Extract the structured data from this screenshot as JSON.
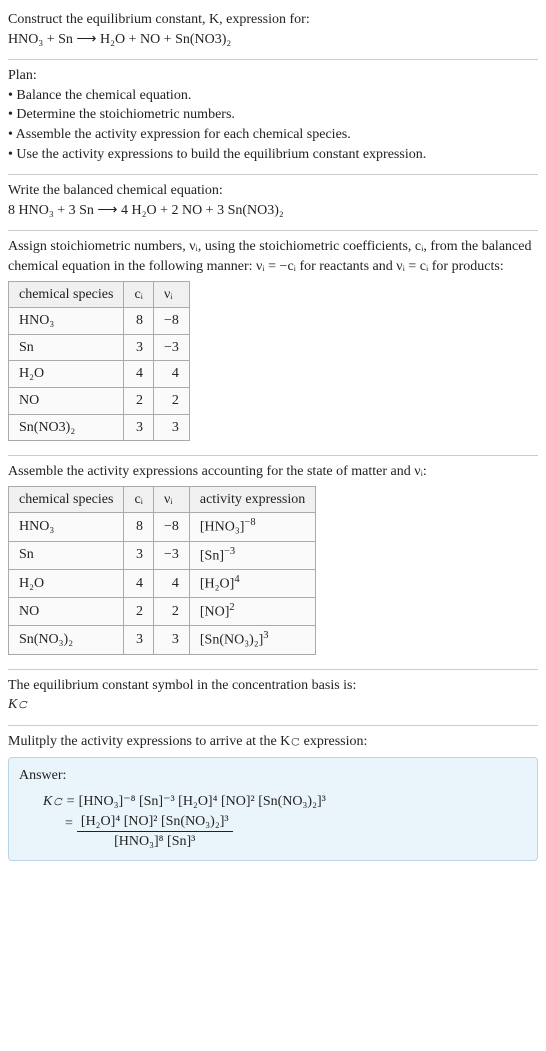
{
  "intro": {
    "line1": "Construct the equilibrium constant, K, expression for:",
    "equation": "HNO₃ + Sn ⟶ H₂O + NO + Sn(NO3)₂"
  },
  "plan": {
    "heading": "Plan:",
    "items": [
      "• Balance the chemical equation.",
      "• Determine the stoichiometric numbers.",
      "• Assemble the activity expression for each chemical species.",
      "• Use the activity expressions to build the equilibrium constant expression."
    ]
  },
  "balanced": {
    "heading": "Write the balanced chemical equation:",
    "equation": "8 HNO₃ + 3 Sn ⟶ 4 H₂O + 2 NO + 3 Sn(NO3)₂"
  },
  "stoich": {
    "heading": "Assign stoichiometric numbers, νᵢ, using the stoichiometric coefficients, cᵢ, from the balanced chemical equation in the following manner: νᵢ = −cᵢ for reactants and νᵢ = cᵢ for products:",
    "headers": [
      "chemical species",
      "cᵢ",
      "νᵢ"
    ],
    "rows": [
      {
        "species": "HNO₃",
        "c": "8",
        "v": "−8"
      },
      {
        "species": "Sn",
        "c": "3",
        "v": "−3"
      },
      {
        "species": "H₂O",
        "c": "4",
        "v": "4"
      },
      {
        "species": "NO",
        "c": "2",
        "v": "2"
      },
      {
        "species": "Sn(NO3)₂",
        "c": "3",
        "v": "3"
      }
    ]
  },
  "activity": {
    "heading": "Assemble the activity expressions accounting for the state of matter and νᵢ:",
    "headers": [
      "chemical species",
      "cᵢ",
      "νᵢ",
      "activity expression"
    ],
    "rows": [
      {
        "species": "HNO₃",
        "c": "8",
        "v": "−8",
        "expr_base": "[HNO₃]",
        "expr_exp": "−8"
      },
      {
        "species": "Sn",
        "c": "3",
        "v": "−3",
        "expr_base": "[Sn]",
        "expr_exp": "−3"
      },
      {
        "species": "H₂O",
        "c": "4",
        "v": "4",
        "expr_base": "[H₂O]",
        "expr_exp": "4"
      },
      {
        "species": "NO",
        "c": "2",
        "v": "2",
        "expr_base": "[NO]",
        "expr_exp": "2"
      },
      {
        "species": "Sn(NO₃)₂",
        "c": "3",
        "v": "3",
        "expr_base": "[Sn(NO₃)₂]",
        "expr_exp": "3"
      }
    ]
  },
  "symbol": {
    "line1": "The equilibrium constant symbol in the concentration basis is:",
    "line2": "K𝚌"
  },
  "multiply": {
    "heading": "Mulitply the activity expressions to arrive at the K𝚌 expression:"
  },
  "answer": {
    "label": "Answer:",
    "kc": "K𝚌 = ",
    "flat": "[HNO₃]⁻⁸ [Sn]⁻³ [H₂O]⁴ [NO]² [Sn(NO₃)₂]³",
    "eq": "= ",
    "frac_num": "[H₂O]⁴ [NO]² [Sn(NO₃)₂]³",
    "frac_den": "[HNO₃]⁸ [Sn]³"
  }
}
